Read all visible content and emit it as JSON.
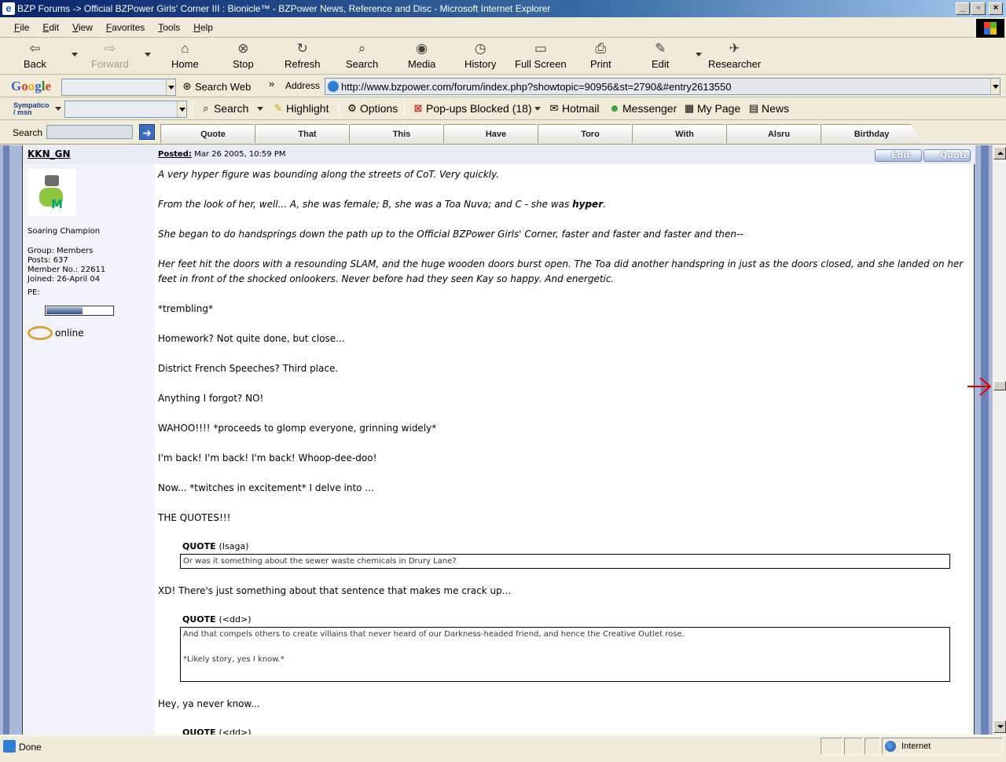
{
  "window": {
    "title": "BZP Forums -> Official BZPower Girls' Corner III : Bionicle™ - BZPower News, Reference and Disc - Microsoft Internet Explorer",
    "buttons": [
      "_",
      "▫",
      "×"
    ]
  },
  "menu": [
    "File",
    "Edit",
    "View",
    "Favorites",
    "Tools",
    "Help"
  ],
  "toolbar": {
    "back": "Back",
    "forward": "Forward",
    "home": "Home",
    "stop": "Stop",
    "refresh": "Refresh",
    "search": "Search",
    "media": "Media",
    "history": "History",
    "fullscreen": "Full Screen",
    "print": "Print",
    "edit": "Edit",
    "researcher": "Researcher"
  },
  "google": {
    "search_web": "Search Web",
    "more": "»",
    "address_label": "Address",
    "address_url": "http://www.bzpower.com/forum/index.php?showtopic=90956&st=2790&#entry2613550"
  },
  "msn": {
    "brand": "Sympatico / msn",
    "search": "Search",
    "highlight": "Highlight",
    "options": "Options",
    "popups": "Pop-ups Blocked (18)",
    "hotmail": "Hotmail",
    "messenger": "Messenger",
    "mypage": "My Page",
    "news": "News"
  },
  "searchbar": {
    "label": "Search",
    "tabs": [
      "Quote",
      "That",
      "This",
      "Have",
      "Toro",
      "With",
      "Alsru",
      "Birthday"
    ]
  },
  "post": {
    "author": "KKN_GN",
    "posted_label": "Posted:",
    "posted_date": "Mar 26 2005, 10:59 PM",
    "edit_btn": "Edit",
    "quote_btn": "Quote",
    "user": {
      "rank": "Soaring Champion",
      "group": "Group: Members",
      "posts": "Posts: 637",
      "member_no": "Member No.: 22611",
      "joined": "Joined: 26-April 04",
      "pe_label": "PE:",
      "pe_level": 0.55,
      "online": "online"
    },
    "paragraphs": {
      "p1": "A very hyper figure was bounding along the streets of CoT. Very quickly.",
      "p2a": "From the look of her, well... A, she was female; B, she was a Toa Nuva; and C - she was ",
      "p2b": "hyper",
      "p2c": ".",
      "p3": "She began to do handsprings down the path up to the Official BZPower Girls' Corner, faster and faster and faster and then--",
      "p4": "Her feet hit the doors with a resounding SLAM, and the huge wooden doors burst open. The Toa did another handspring in just as the doors closed, and she landed on her feet in front of the shocked onlookers. Never before had they seen Kay so happy. And energetic.",
      "p5": "*trembling*",
      "p6": "Homework? Not quite done, but close...",
      "p7": "District French Speeches? Third place.",
      "p8": "Anything I forgot? NO!",
      "p9": "WAHOO!!!! *proceeds to glomp everyone, grinning widely*",
      "p10": "I'm back! I'm back! I'm back! Whoop-dee-doo!",
      "p11": "Now... *twitches in excitement* I delve into ...",
      "p12": "THE QUOTES!!!",
      "q1_label": "QUOTE",
      "q1_src": "(Isaga)",
      "q1_text": "Or was it something about the sewer waste chemicals in Drury Lane?",
      "p13": "XD! There's just something about that sentence that makes me crack up...",
      "q2_label": "QUOTE",
      "q2_src": "(<dd>)",
      "q2_text1": "And that compels others to create villains that never heard of our Darkness-headed friend, and hence the Creative Outlet rose.",
      "q2_text2": "*Likely story, yes I know.*",
      "p14": "Hey, ya never know...",
      "q3_label": "QUOTE",
      "q3_src": "(<dd>)"
    }
  },
  "status": {
    "text": "Done",
    "zone": "Internet"
  },
  "colors": {
    "titlebar": "#0a246a",
    "chrome": "#efebd8",
    "page_border": "#6d82b8",
    "annotation_arrow": "#e00000"
  }
}
